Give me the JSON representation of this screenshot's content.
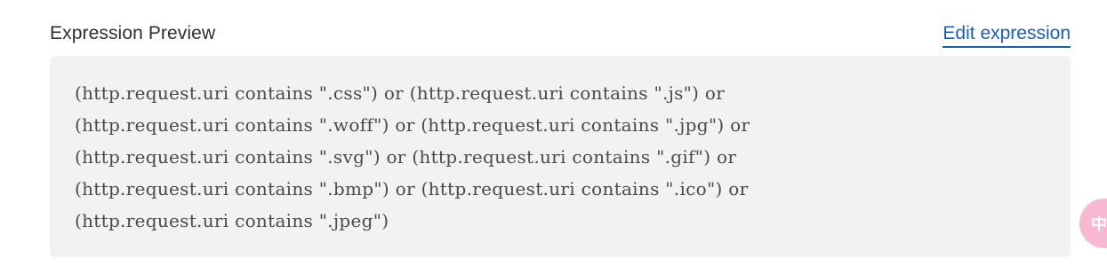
{
  "header": {
    "title": "Expression Preview",
    "edit_link_label": "Edit expression"
  },
  "expression": {
    "lines": [
      "(http.request.uri contains \".css\") or (http.request.uri contains \".js\") or",
      "(http.request.uri contains \".woff\") or (http.request.uri contains \".jpg\") or",
      "(http.request.uri contains \".svg\") or (http.request.uri contains \".gif\") or",
      "(http.request.uri contains \".bmp\") or (http.request.uri contains \".ico\") or",
      "(http.request.uri contains \".jpeg\")"
    ]
  },
  "floating_widget": {
    "icon": "translate-icon",
    "glyph": "中",
    "color": "#f7b9d2"
  },
  "colors": {
    "link": "#1a5fb4",
    "box_background": "#f2f2f2"
  }
}
